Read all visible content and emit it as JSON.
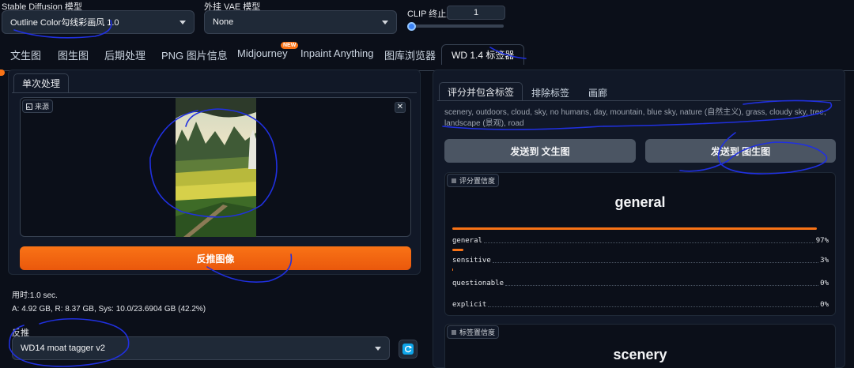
{
  "top": {
    "sd_model_label": "Stable Diffusion 模型",
    "sd_model_value": "Outline Color勾线彩画风 1.0",
    "vae_label": "外挂 VAE 模型",
    "vae_value": "None",
    "clip_label": "CLIP 终止层数",
    "clip_value": "1"
  },
  "tabs": [
    {
      "label": "文生图"
    },
    {
      "label": "图生图"
    },
    {
      "label": "后期处理"
    },
    {
      "label": "PNG 图片信息"
    },
    {
      "label": "Midjourney",
      "badge": "NEW"
    },
    {
      "label": "Inpaint Anything"
    },
    {
      "label": "图库浏览器"
    },
    {
      "label": "WD 1.4 标签器",
      "active": true
    }
  ],
  "left": {
    "subtab": "单次处理",
    "source_chip": "来源",
    "interrogate_button": "反推图像",
    "time_text": "用时:1.0 sec.",
    "memory_text": "A: 4.92 GB, R: 8.37 GB, Sys: 10.0/23.6904 GB (42.2%)",
    "interrogator_label": "反推",
    "interrogator_value": "WD14 moat tagger v2"
  },
  "right": {
    "subtabs": [
      "评分并包含标签",
      "排除标签",
      "画廊"
    ],
    "tags_text": "scenery, outdoors, cloud, sky, no humans, day, mountain, blue sky, nature (自然主义), grass, cloudy sky, tree, landscape (景观), road",
    "send_txt2img": "发送到 文生图",
    "send_img2img": "发送到 图生图",
    "rating_chip": "评分置信度",
    "rating_title": "general",
    "ratings": [
      {
        "name": "general",
        "value": "97%",
        "fraction": 0.97
      },
      {
        "name": "sensitive",
        "value": "3%",
        "fraction": 0.03
      },
      {
        "name": "questionable",
        "value": "0%",
        "fraction": 0.0
      },
      {
        "name": "explicit",
        "value": "0%",
        "fraction": 0.0
      }
    ],
    "tag_conf_chip": "标签置信度",
    "tag_conf_title": "scenery"
  },
  "colors": {
    "accent": "#f97316",
    "background": "#0b0f19",
    "panel": "#111827"
  }
}
